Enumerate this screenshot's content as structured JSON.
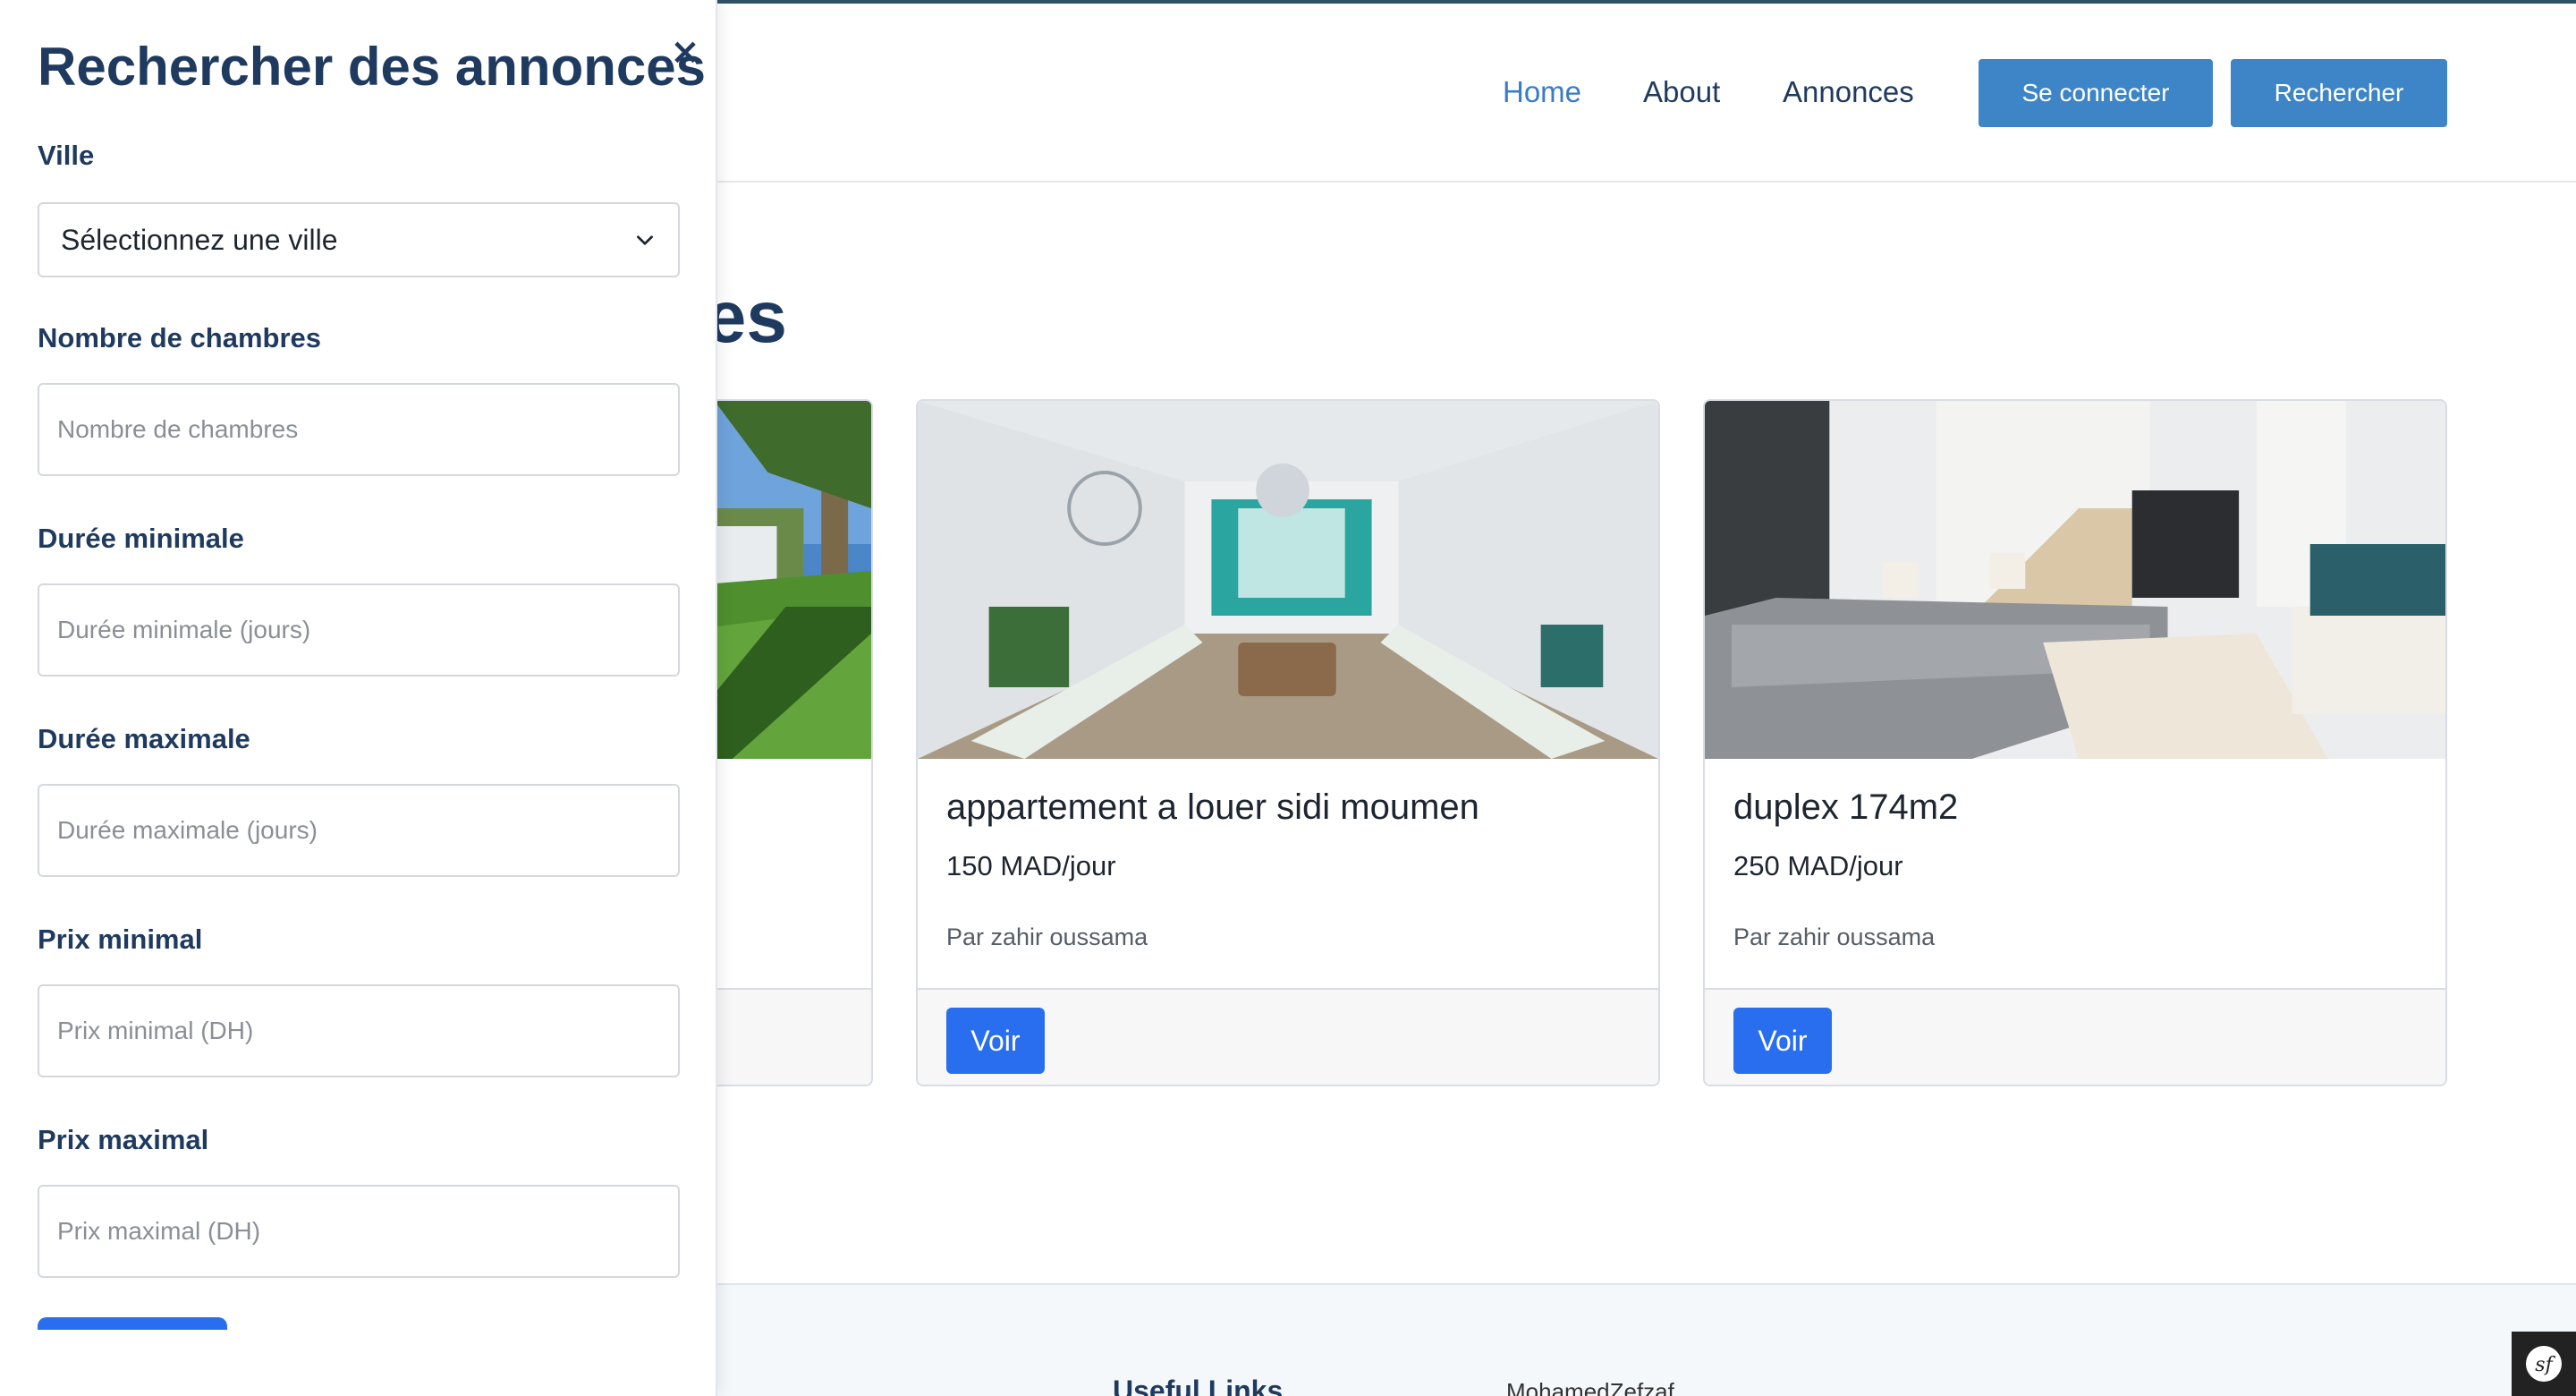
{
  "nav": {
    "items": [
      "Home",
      "About",
      "Annonces"
    ],
    "login_label": "Se connecter",
    "search_label": "Rechercher"
  },
  "main": {
    "section_title_visible": "es"
  },
  "listings": [
    {
      "title": "",
      "price": "",
      "owner": "",
      "button": ""
    },
    {
      "title": "appartement a louer sidi moumen",
      "price": "150 MAD/jour",
      "owner": "Par zahir oussama",
      "button": "Voir"
    },
    {
      "title": "duplex 174m2",
      "price": "250 MAD/jour",
      "owner": "Par zahir oussama",
      "button": "Voir"
    }
  ],
  "footer": {
    "links_heading": "Useful Links",
    "author": "MohamedZefzaf"
  },
  "search_panel": {
    "title": "Rechercher des annonces",
    "close_glyph": "×",
    "city_label": "Ville",
    "city_selected": "Sélectionnez une ville",
    "rooms_label": "Nombre de chambres",
    "rooms_placeholder": "Nombre de chambres",
    "min_duration_label": "Durée minimale",
    "min_duration_placeholder": "Durée minimale (jours)",
    "max_duration_label": "Durée maximale",
    "max_duration_placeholder": "Durée maximale (jours)",
    "min_price_label": "Prix minimal",
    "min_price_placeholder": "Prix minimal (DH)",
    "max_price_label": "Prix maximal",
    "max_price_placeholder": "Prix maximal (DH)"
  },
  "colors": {
    "accent": "#3d85c6",
    "primary_button": "#2a6ef0",
    "heading": "#1f3a5f"
  }
}
